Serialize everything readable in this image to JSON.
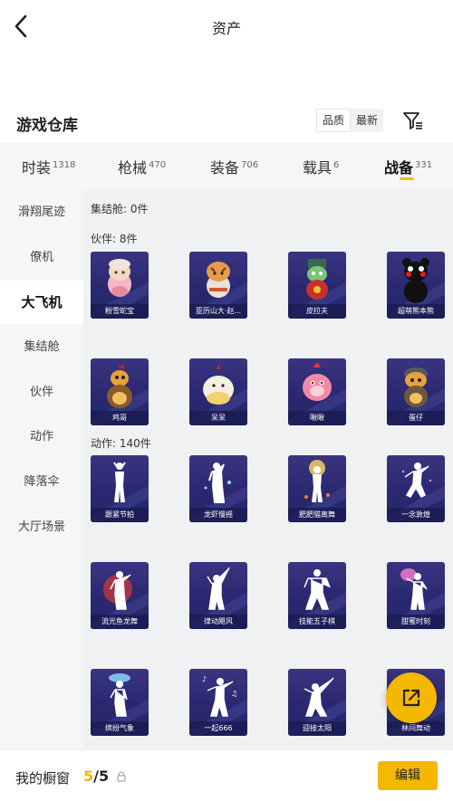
{
  "header": {
    "title": "资产"
  },
  "section": {
    "title": "游戏仓库",
    "sort_options": [
      "品质",
      "最新"
    ],
    "active_sort": 0
  },
  "tabs": [
    {
      "label": "时装",
      "count": "1318"
    },
    {
      "label": "枪械",
      "count": "470"
    },
    {
      "label": "装备",
      "count": "706"
    },
    {
      "label": "载具",
      "count": "6"
    },
    {
      "label": "战备",
      "count": "331",
      "active": true
    }
  ],
  "sidebar": [
    {
      "label": "滑翔尾迹"
    },
    {
      "label": "僚机"
    },
    {
      "label": "大飞机",
      "active": true
    },
    {
      "label": "集结舱"
    },
    {
      "label": "伙伴"
    },
    {
      "label": "动作"
    },
    {
      "label": "降落伞"
    },
    {
      "label": "大厅场景"
    }
  ],
  "groups": {
    "capsule": "集结舱: 0件",
    "partner": "伙伴: 8件",
    "emote": "动作: 140件"
  },
  "partners": [
    {
      "name": "粉雪蛇宝"
    },
    {
      "name": "亚历山大·赵..."
    },
    {
      "name": "皮拉夫"
    },
    {
      "name": "超萌熊本熊"
    },
    {
      "name": "鸡哥"
    },
    {
      "name": "呆呆"
    },
    {
      "name": "啾啾"
    },
    {
      "name": "蛋仔"
    }
  ],
  "emotes": [
    {
      "name": "跟紧节拍"
    },
    {
      "name": "龙虾慢摇"
    },
    {
      "name": "肥肥猫离舞"
    },
    {
      "name": "一念敦煌"
    },
    {
      "name": "流光鱼龙舞"
    },
    {
      "name": "律动飓风"
    },
    {
      "name": "技能五子棋"
    },
    {
      "name": "甜蜜时刻"
    },
    {
      "name": "缤纷气象"
    },
    {
      "name": "一起666"
    },
    {
      "name": "迎接太阳"
    },
    {
      "name": "林间舞动"
    }
  ],
  "bottom": {
    "label": "我的橱窗",
    "current": "5",
    "total": "/5",
    "edit_label": "编辑"
  },
  "colors": {
    "accent": "#f5b800",
    "card_bg": "#2a2870"
  }
}
